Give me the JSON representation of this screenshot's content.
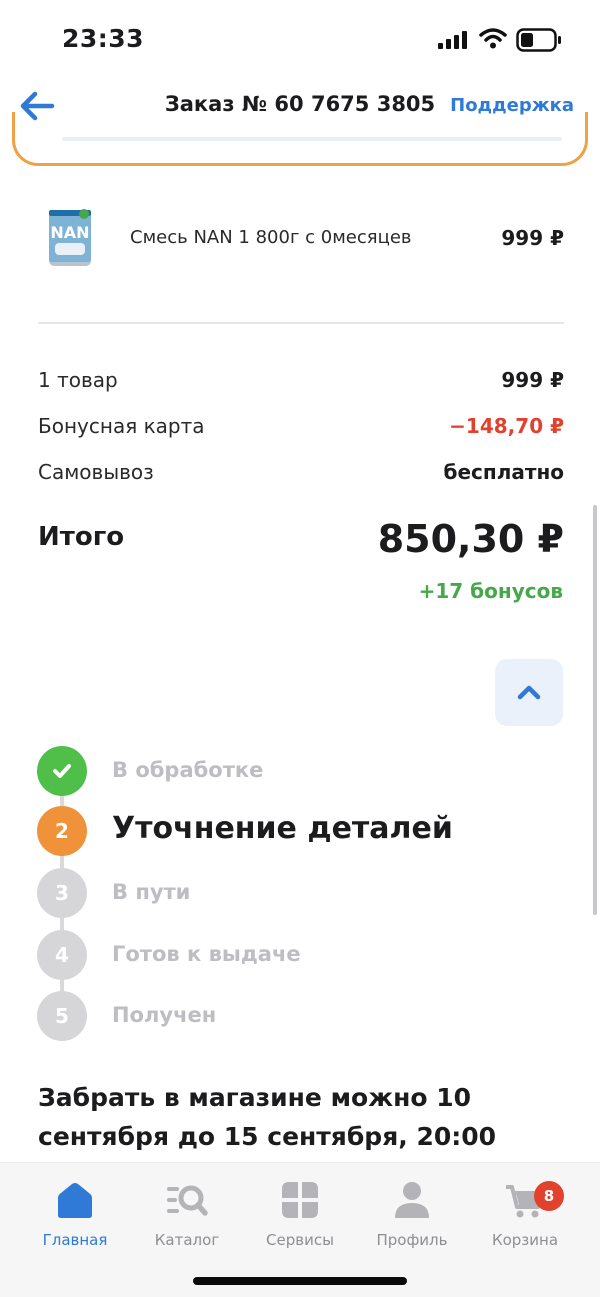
{
  "status_bar": {
    "time": "23:33"
  },
  "header": {
    "title": "Заказ № 60 7675 3805",
    "support_label": "Поддержка"
  },
  "product": {
    "name": "Смесь NAN 1 800г с 0месяцев",
    "price": "999 ₽"
  },
  "summary": {
    "items": {
      "label": "1 товар",
      "value": "999 ₽"
    },
    "bonus_card": {
      "label": "Бонусная карта",
      "value": "−148,70 ₽"
    },
    "pickup": {
      "label": "Самовывоз",
      "value": "бесплатно"
    },
    "total_label": "Итого",
    "total_value": "850,30 ₽",
    "bonus_earned": "+17 бонусов"
  },
  "steps": [
    {
      "number": "",
      "label": "В обработке",
      "state": "done"
    },
    {
      "number": "2",
      "label": "Уточнение деталей",
      "state": "active"
    },
    {
      "number": "3",
      "label": "В пути",
      "state": "pending"
    },
    {
      "number": "4",
      "label": "Готов к выдаче",
      "state": "pending"
    },
    {
      "number": "5",
      "label": "Получен",
      "state": "pending"
    }
  ],
  "pickup_info": "Забрать в магазине можно 10 сентября до 15 сентября, 20:00",
  "tab_bar": {
    "tabs": [
      {
        "label": "Главная",
        "icon": "home-icon",
        "active": true
      },
      {
        "label": "Каталог",
        "icon": "catalog-search-icon",
        "active": false
      },
      {
        "label": "Сервисы",
        "icon": "services-grid-icon",
        "active": false
      },
      {
        "label": "Профиль",
        "icon": "profile-icon",
        "active": false
      },
      {
        "label": "Корзина",
        "icon": "cart-icon",
        "active": false
      }
    ],
    "cart_badge": "8"
  },
  "colors": {
    "accent": "#2f7ad6",
    "discount": "#e1412d",
    "bonus": "#45a84a",
    "step_done": "#4fbf4a",
    "step_active": "#f0923a",
    "card_border": "#f0a045"
  }
}
